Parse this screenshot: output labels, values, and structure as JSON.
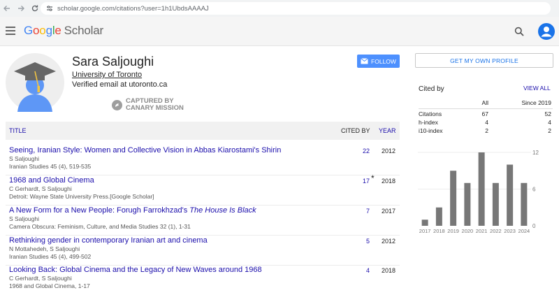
{
  "browser": {
    "url": "scholar.google.com/citations?user=1h1UbdsAAAAJ"
  },
  "header": {
    "logo_google": [
      "G",
      "o",
      "o",
      "g",
      "l",
      "e"
    ],
    "logo_scholar": "Scholar"
  },
  "profile": {
    "name": "Sara Saljoughi",
    "affiliation": "University of Toronto",
    "email": "Verified email at utoronto.ca",
    "follow_label": "FOLLOW",
    "canary_line1": "CAPTURED BY",
    "canary_line2": "CANARY MISSION"
  },
  "table": {
    "col_title": "TITLE",
    "col_cited": "CITED BY",
    "col_year": "YEAR",
    "rows": [
      {
        "title": "Seeing, Iranian Style: Women and Collective Vision in Abbas Kiarostami's Shirin",
        "authors": "S Saljoughi",
        "venue": "Iranian Studies 45 (4), 519-535",
        "cited": "22",
        "year": "2012"
      },
      {
        "title": "1968 and Global Cinema",
        "authors": "C Gerhardt, S Saljoughi",
        "venue": "Detroit: Wayne State University Press.[Google Scholar]",
        "cited": "17",
        "star": "*",
        "year": "2018"
      },
      {
        "title_plain": "A New Form for a New People: Forugh Farrokhzad's ",
        "title_italic": "The House Is Black",
        "authors": "S Saljoughi",
        "venue": "Camera Obscura: Feminism, Culture, and Media Studies 32 (1), 1-31",
        "cited": "7",
        "year": "2017"
      },
      {
        "title": "Rethinking gender in contemporary Iranian art and cinema",
        "authors": "N Mottahedeh, S Saljoughi",
        "venue": "Iranian Studies 45 (4), 499-502",
        "cited": "5",
        "year": "2012"
      },
      {
        "title": "Looking Back: Global Cinema and the Legacy of New Waves around 1968",
        "authors": "C Gerhardt, S Saljoughi",
        "venue": "1968 and Global Cinema, 1-17",
        "cited": "4",
        "year": "2018"
      }
    ]
  },
  "sidebar": {
    "own_profile_label": "GET MY OWN PROFILE",
    "cited_by_title": "Cited by",
    "view_all": "VIEW ALL",
    "col_all": "All",
    "col_since": "Since 2019",
    "metrics": [
      {
        "label": "Citations",
        "all": "67",
        "since": "52"
      },
      {
        "label": "h-index",
        "all": "4",
        "since": "4"
      },
      {
        "label": "i10-index",
        "all": "2",
        "since": "2"
      }
    ]
  },
  "chart_data": {
    "type": "bar",
    "categories": [
      "2017",
      "2018",
      "2019",
      "2020",
      "2021",
      "2022",
      "2023",
      "2024"
    ],
    "values": [
      1,
      3,
      9,
      7,
      12,
      7,
      10,
      7
    ],
    "yticks": [
      0,
      6,
      12
    ],
    "ylim": [
      0,
      12
    ],
    "bar_color": "#777777"
  }
}
